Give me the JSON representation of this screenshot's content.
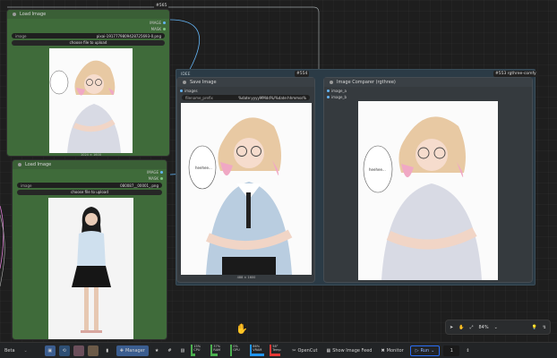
{
  "load_image_1": {
    "badge": "#565",
    "title": "Load Image",
    "outputs": [
      {
        "label": "IMAGE",
        "color": "#64b5f6"
      },
      {
        "label": "MASK",
        "color": "#81c784"
      }
    ],
    "image_label": "image",
    "image_value": "pixai-1917779809428725693-0.png",
    "upload_label": "choose file to upload",
    "caption": "1024 × 1600"
  },
  "load_image_2": {
    "title": "Load Image",
    "outputs": [
      {
        "label": "IMAGE",
        "color": "#64b5f6"
      },
      {
        "label": "MASK",
        "color": "#81c784"
      }
    ],
    "image_label": "image",
    "image_value": "080087__00001_.png",
    "upload_label": "choose file to upload"
  },
  "group": {
    "title": "IDEE"
  },
  "save_image": {
    "badge": "#554",
    "title": "Save Image",
    "input_label": "images",
    "prefix_label": "filename_prefix",
    "prefix_value": "%date:yyyyMMdd%/%date:hhmmss%",
    "caption": "488 × 1600"
  },
  "compare": {
    "badge": "#553 rgthree-comfy",
    "title": "Image Comparer (rgthree)",
    "inputs": [
      "image_a",
      "image_b"
    ]
  },
  "speech_bubble": "heehee...",
  "canvas_controls": {
    "zoom": "84%"
  },
  "toolbar": {
    "left_label": "Beta",
    "manager": "Manager",
    "stats": [
      {
        "label": "CPU",
        "value": "15%",
        "level": 0.15,
        "color": "#4caf50"
      },
      {
        "label": "RAM",
        "value": "37%",
        "level": 0.37,
        "color": "#4caf50"
      },
      {
        "label": "GPU",
        "value": "0%",
        "level": 0.0,
        "color": "#4caf50"
      },
      {
        "label": "VRAM",
        "value": "86%",
        "level": 0.86,
        "color": "#2196f3"
      },
      {
        "label": "Temp",
        "value": "58°",
        "level": 0.58,
        "color": "#e53935"
      }
    ],
    "opencut": "OpenCut",
    "feed": "Show Image Feed",
    "monitor": "Monitor",
    "run": "Run",
    "batch": "1",
    "accent": "#2a6df4"
  }
}
